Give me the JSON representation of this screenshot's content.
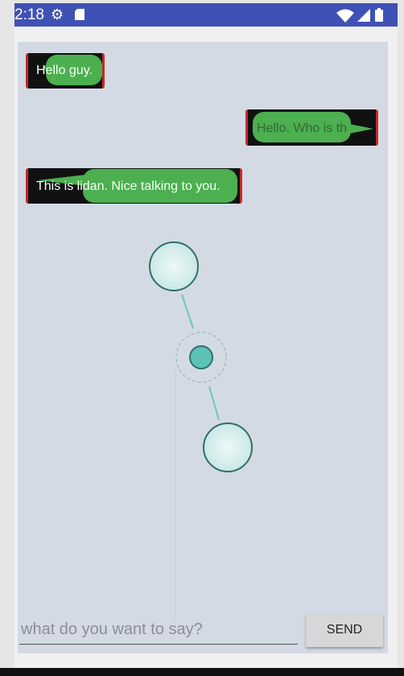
{
  "status_bar": {
    "time": "2:18",
    "color": "#3f51b5",
    "icons": [
      "settings-gear-icon",
      "sd-card-icon",
      "wifi-icon",
      "signal-icon",
      "battery-icon"
    ]
  },
  "messages": [
    {
      "text": "Hello guy.",
      "side": "left"
    },
    {
      "text": "Hello. Who is th",
      "side": "right"
    },
    {
      "text": "This is lidan. Nice talking to you.",
      "side": "left"
    }
  ],
  "composer": {
    "placeholder": "what do you want to say?",
    "value": "",
    "send_label": "SEND"
  },
  "colors": {
    "bubble_green": "#4caf50",
    "chat_background": "#d3dae4",
    "node_fill": "#d7efee",
    "node_stroke": "#2f6f6a",
    "center_node": "#5cc2b8",
    "link": "#6ec6bd"
  }
}
